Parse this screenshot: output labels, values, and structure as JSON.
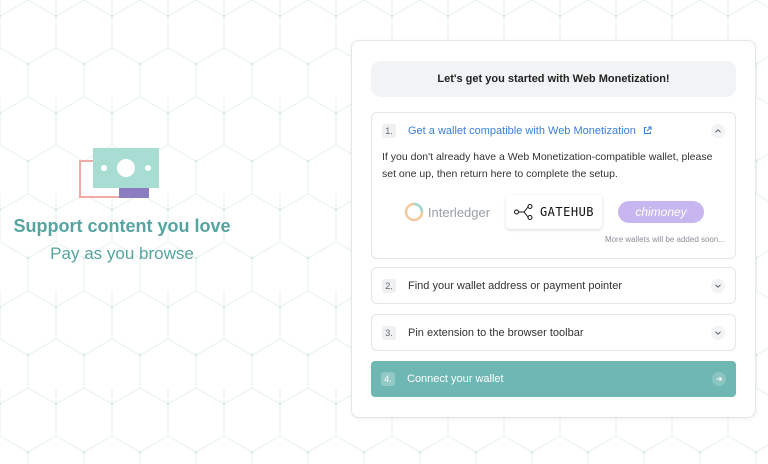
{
  "hero": {
    "title": "Support content you love",
    "subtitle": "Pay as you browse"
  },
  "card": {
    "header": "Let's get you started with Web Monetization!",
    "steps": [
      {
        "number": "1.",
        "title": "Get a wallet compatible with Web Monetization",
        "expanded": true,
        "description": "If you don't already have a Web Monetization-compatible wallet, please set one up, then return here to complete the setup.",
        "wallets": [
          "Interledger",
          "GATEHUB",
          "chimoney"
        ],
        "note": "More wallets will be added soon..."
      },
      {
        "number": "2.",
        "title": "Find your wallet address or payment pointer",
        "expanded": false
      },
      {
        "number": "3.",
        "title": "Pin extension to the browser toolbar",
        "expanded": false
      },
      {
        "number": "4.",
        "title": "Connect your wallet",
        "active": true
      }
    ]
  },
  "colors": {
    "accent": "#6eb7b2",
    "hero_text": "#56a4a0",
    "link": "#3b7fd6",
    "chimoney": "#c7b6ef"
  },
  "icons": {
    "logo": "money-bill-icon",
    "external": "external-link-icon",
    "chevron_up": "chevron-up-icon",
    "chevron_down": "chevron-down-icon",
    "arrow": "arrow-right-icon"
  }
}
